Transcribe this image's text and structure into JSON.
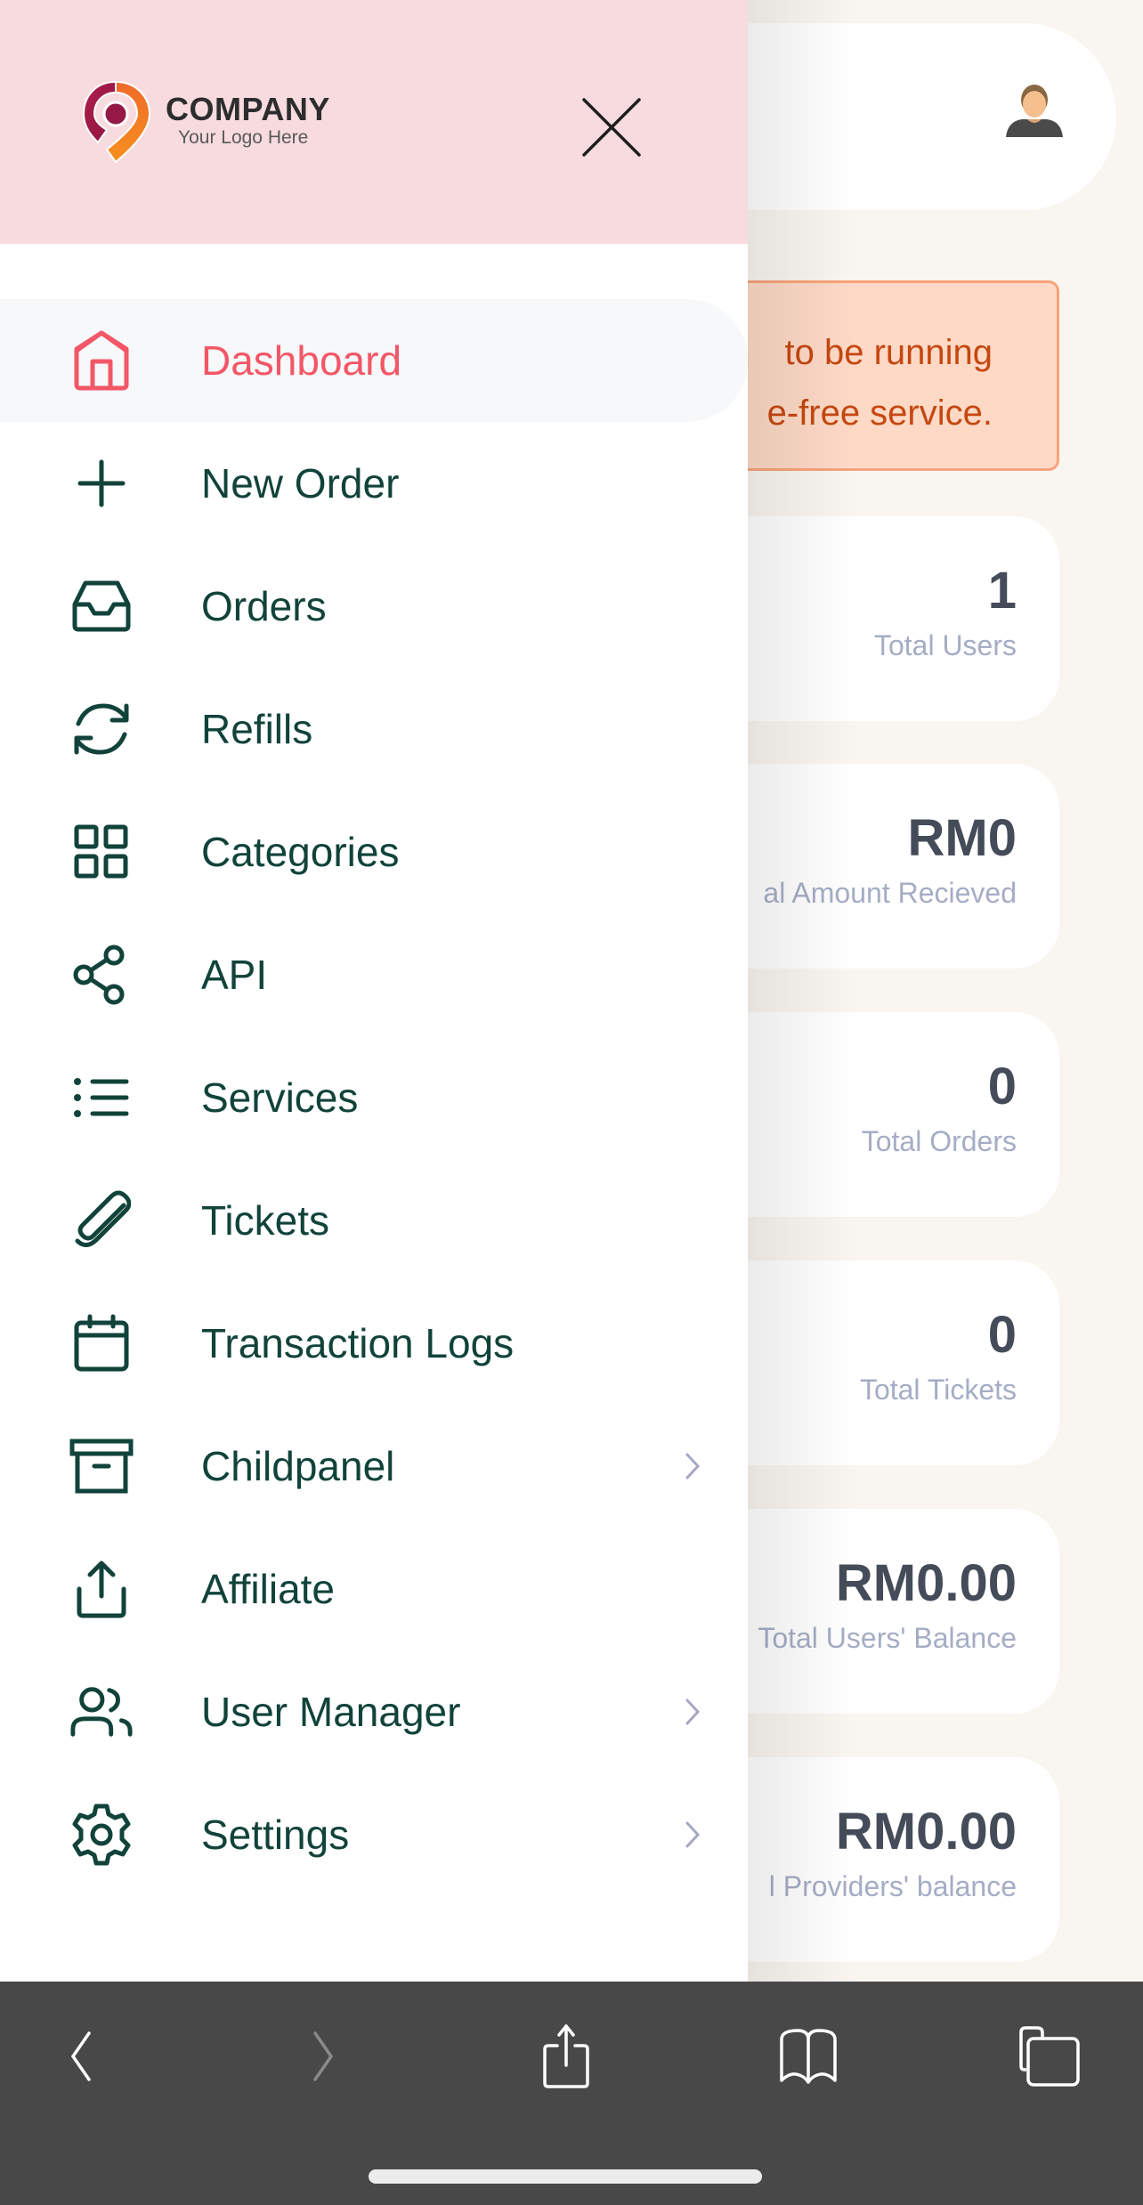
{
  "header": {
    "logo_name": "COMPANY",
    "logo_tagline": "Your Logo Here",
    "close_icon": "close-icon",
    "avatar_icon": "user-avatar-icon"
  },
  "alert": {
    "lines": [
      "to be running",
      "e-free service."
    ],
    "colors": {
      "background": "#fdd9c6",
      "border": "#f8a37b",
      "text": "#c6470f"
    }
  },
  "stats": [
    {
      "value": "1",
      "label": "Total Users"
    },
    {
      "value": "RM0",
      "label": "al Amount Recieved"
    },
    {
      "value": "0",
      "label": "Total Orders"
    },
    {
      "value": "0",
      "label": "Total Tickets"
    },
    {
      "value": "RM0.00",
      "label": "Total Users' Balance"
    },
    {
      "value": "RM0.00",
      "label": "l Providers' balance"
    }
  ],
  "sidebar": {
    "active_color": "#f25767",
    "text_color": "#11433a",
    "items": [
      {
        "label": "Dashboard",
        "icon": "home-icon",
        "active": true,
        "has_submenu": false
      },
      {
        "label": "New Order",
        "icon": "plus-icon",
        "active": false,
        "has_submenu": false
      },
      {
        "label": "Orders",
        "icon": "inbox-icon",
        "active": false,
        "has_submenu": false
      },
      {
        "label": "Refills",
        "icon": "refresh-icon",
        "active": false,
        "has_submenu": false
      },
      {
        "label": "Categories",
        "icon": "grid-icon",
        "active": false,
        "has_submenu": false
      },
      {
        "label": "API",
        "icon": "share-icon",
        "active": false,
        "has_submenu": false
      },
      {
        "label": "Services",
        "icon": "list-icon",
        "active": false,
        "has_submenu": false
      },
      {
        "label": "Tickets",
        "icon": "paperclip-icon",
        "active": false,
        "has_submenu": false
      },
      {
        "label": "Transaction Logs",
        "icon": "calendar-icon",
        "active": false,
        "has_submenu": false
      },
      {
        "label": "Childpanel",
        "icon": "archive-icon",
        "active": false,
        "has_submenu": true
      },
      {
        "label": "Affiliate",
        "icon": "upload-icon",
        "active": false,
        "has_submenu": false
      },
      {
        "label": "User Manager",
        "icon": "users-icon",
        "active": false,
        "has_submenu": true
      },
      {
        "label": "Settings",
        "icon": "gear-icon",
        "active": false,
        "has_submenu": true
      }
    ]
  },
  "browser_toolbar": {
    "buttons": [
      {
        "name": "back",
        "icon": "chevron-left-icon",
        "enabled": true
      },
      {
        "name": "forward",
        "icon": "chevron-right-icon",
        "enabled": false
      },
      {
        "name": "share",
        "icon": "share-upload-icon",
        "enabled": true
      },
      {
        "name": "bookmarks",
        "icon": "book-icon",
        "enabled": true
      },
      {
        "name": "tabs",
        "icon": "tabs-icon",
        "enabled": true
      }
    ]
  }
}
